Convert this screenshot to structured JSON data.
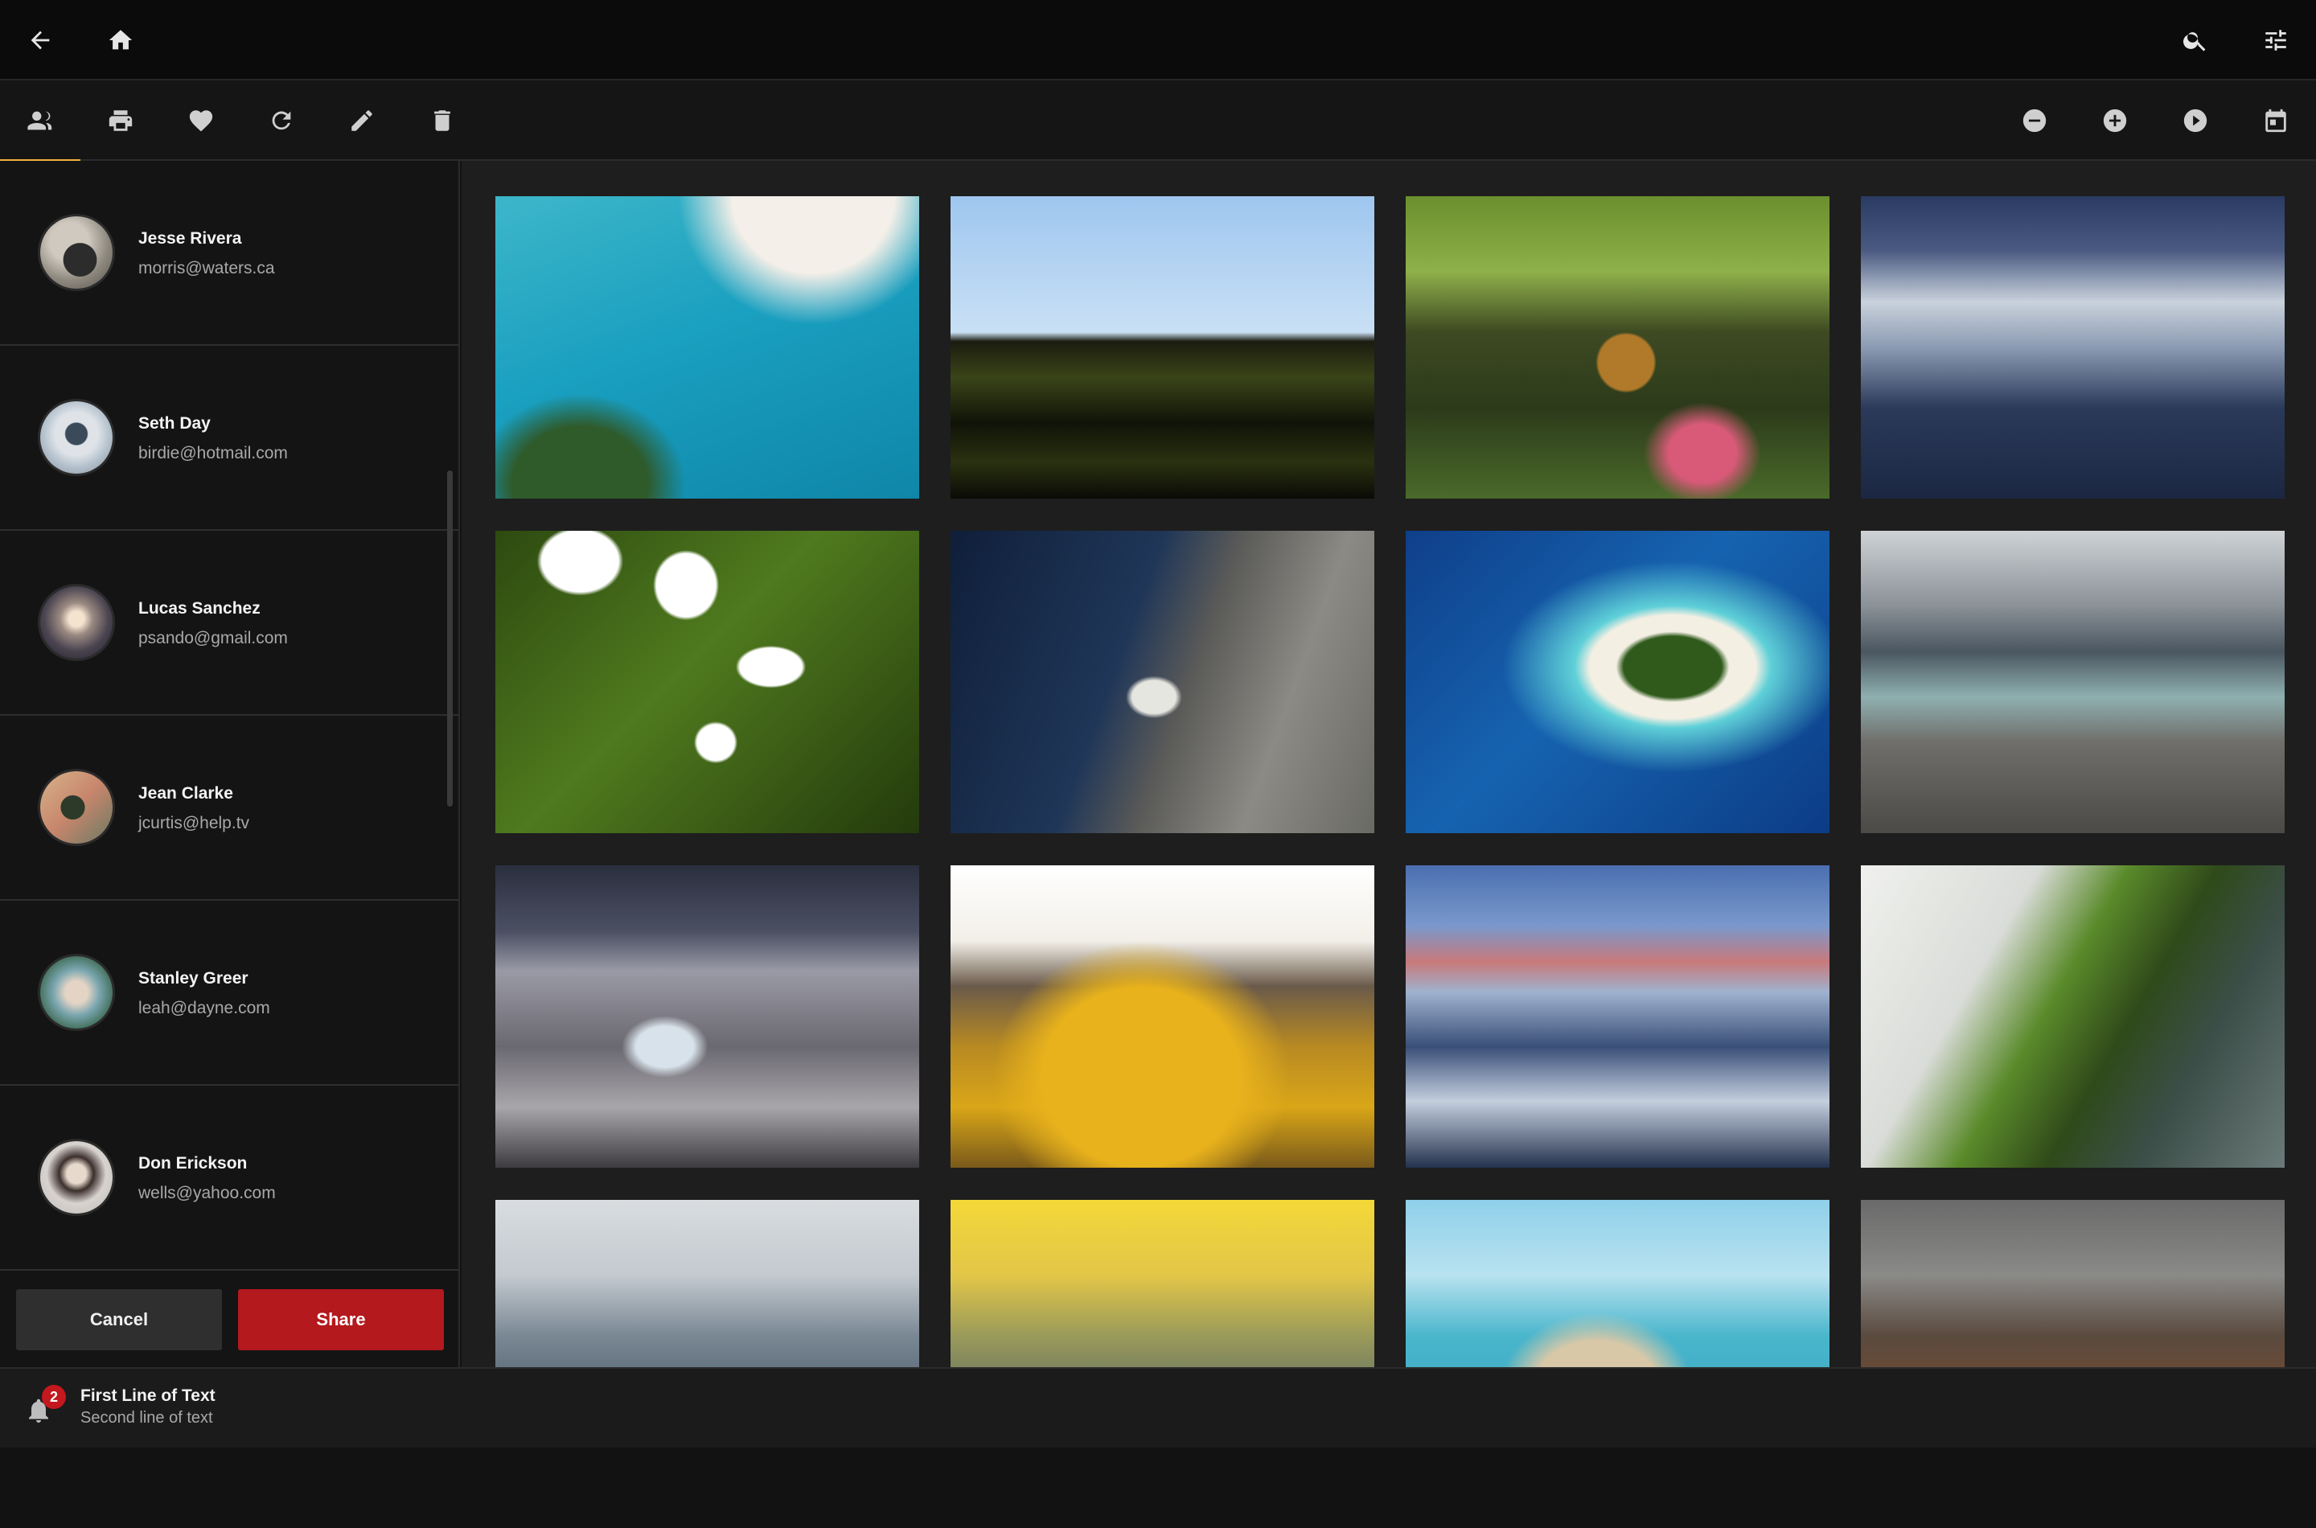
{
  "topbar": {
    "left_icons": [
      "back-arrow-icon",
      "home-icon"
    ],
    "right_icons": [
      "search-icon",
      "tune-icon"
    ]
  },
  "toolbar": {
    "left_icons": [
      "people-icon",
      "print-icon",
      "heart-icon",
      "refresh-icon",
      "edit-icon",
      "delete-icon"
    ],
    "right_icons": [
      "zoom-out-icon",
      "zoom-in-icon",
      "play-icon",
      "calendar-icon"
    ],
    "active_index": 0,
    "accent_color": "#f2b23b"
  },
  "contacts": [
    {
      "name": "Jesse Rivera",
      "email": "morris@waters.ca"
    },
    {
      "name": "Seth Day",
      "email": "birdie@hotmail.com"
    },
    {
      "name": "Lucas Sanchez",
      "email": "psando@gmail.com"
    },
    {
      "name": "Jean Clarke",
      "email": "jcurtis@help.tv"
    },
    {
      "name": "Stanley Greer",
      "email": "leah@dayne.com"
    },
    {
      "name": "Don Erickson",
      "email": "wells@yahoo.com"
    }
  ],
  "actions": {
    "cancel_label": "Cancel",
    "share_label": "Share",
    "share_color": "#b3191d"
  },
  "status": {
    "badge_count": "2",
    "line1": "First Line of Text",
    "line2": "Second line of text"
  }
}
